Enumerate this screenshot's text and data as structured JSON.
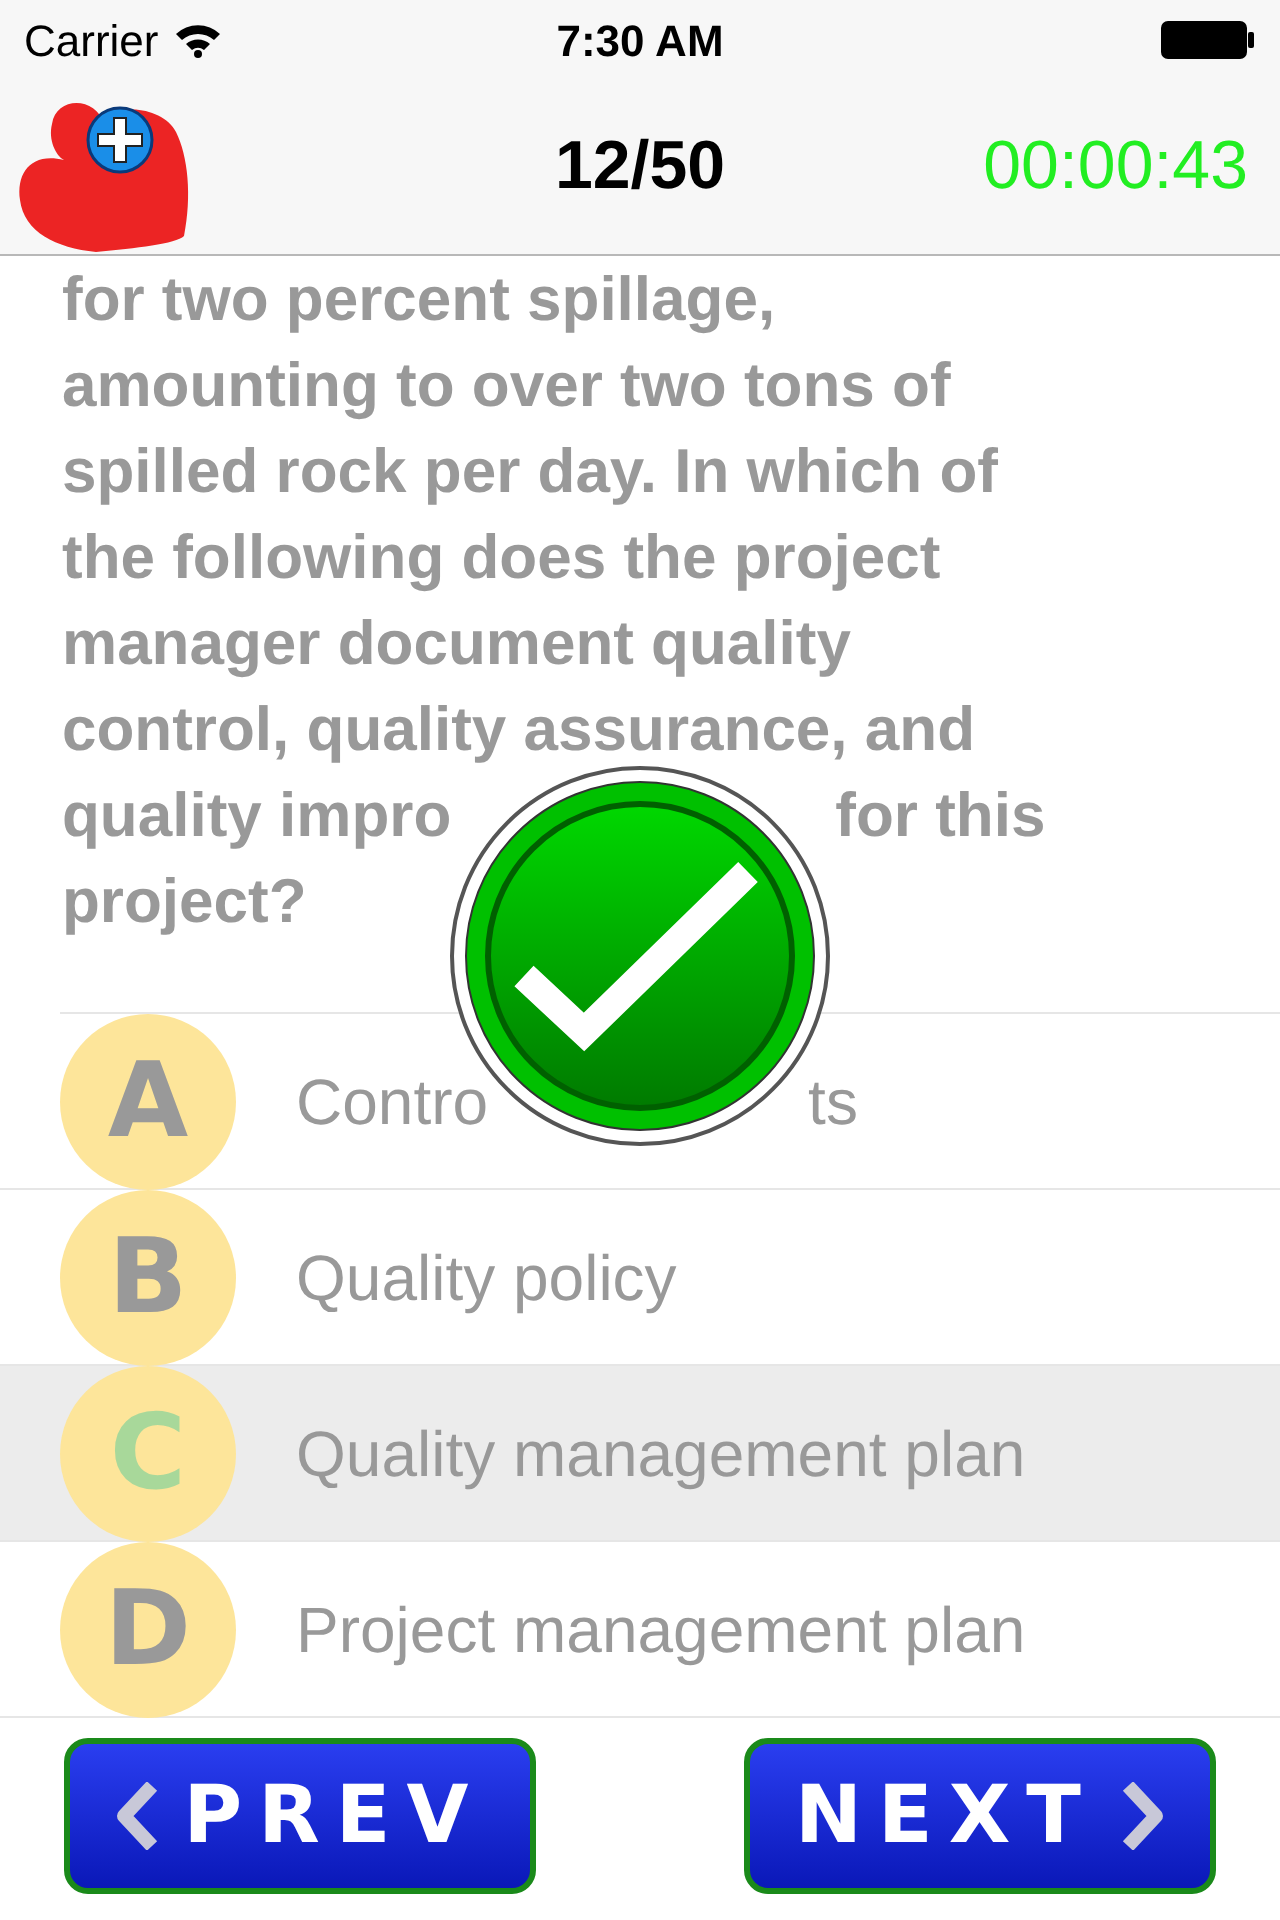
{
  "status_bar": {
    "carrier": "Carrier",
    "time": "7:30 AM"
  },
  "header": {
    "progress": "12/50",
    "timer": "00:00:43"
  },
  "question_lines": [
    {
      "text": "for two percent spillage,"
    },
    {
      "text": "amounting to over two tons of"
    },
    {
      "text": "spilled rock per day. In which of"
    },
    {
      "text": "the following does the project"
    },
    {
      "text": "manager document quality"
    },
    {
      "text": "control, quality assurance, and"
    },
    {
      "text": "quality impro",
      "text_end": "for this"
    },
    {
      "text": "project?"
    }
  ],
  "result": {
    "kind": "correct"
  },
  "options": [
    {
      "letter": "A",
      "text": "Contro",
      "text_end": "ts",
      "selected": false
    },
    {
      "letter": "B",
      "text": "Quality policy",
      "selected": false
    },
    {
      "letter": "C",
      "text": "Quality management plan",
      "selected": true
    },
    {
      "letter": "D",
      "text": "Project management plan",
      "selected": false
    }
  ],
  "buttons": {
    "prev": "PREV",
    "next": "NEXT"
  }
}
